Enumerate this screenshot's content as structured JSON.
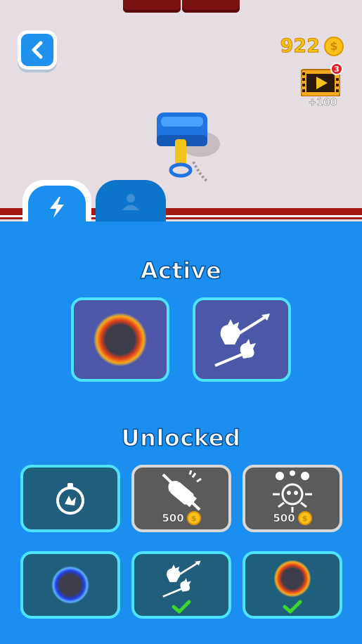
{
  "hud": {
    "coin_count": "922",
    "coin_symbol": "$",
    "video_badge_count": "3",
    "video_reward": "+100"
  },
  "tabs": [
    {
      "icon": "lightning-icon",
      "active": true
    },
    {
      "icon": "person-icon",
      "active": false
    }
  ],
  "active_section": {
    "title": "Active",
    "slots": [
      {
        "icon": "fire-ring-icon"
      },
      {
        "icon": "skull-spears-icon"
      }
    ]
  },
  "unlocked_section": {
    "title": "Unlocked",
    "slots": [
      {
        "icon": "stopwatch-icon",
        "state": "unlocked"
      },
      {
        "icon": "bullet-icon",
        "state": "locked",
        "price": "500"
      },
      {
        "icon": "skull-orbit-icon",
        "state": "locked",
        "price": "500"
      },
      {
        "icon": "blue-ring-icon",
        "state": "unlocked"
      },
      {
        "icon": "skull-spears-icon",
        "state": "equipped"
      },
      {
        "icon": "fire-ring-icon",
        "state": "equipped"
      }
    ]
  },
  "colors": {
    "panel_blue": "#1a8ff0",
    "slot_border": "#4de3ff",
    "coin_gold": "#f7c21c",
    "check_green": "#3ed62d"
  }
}
